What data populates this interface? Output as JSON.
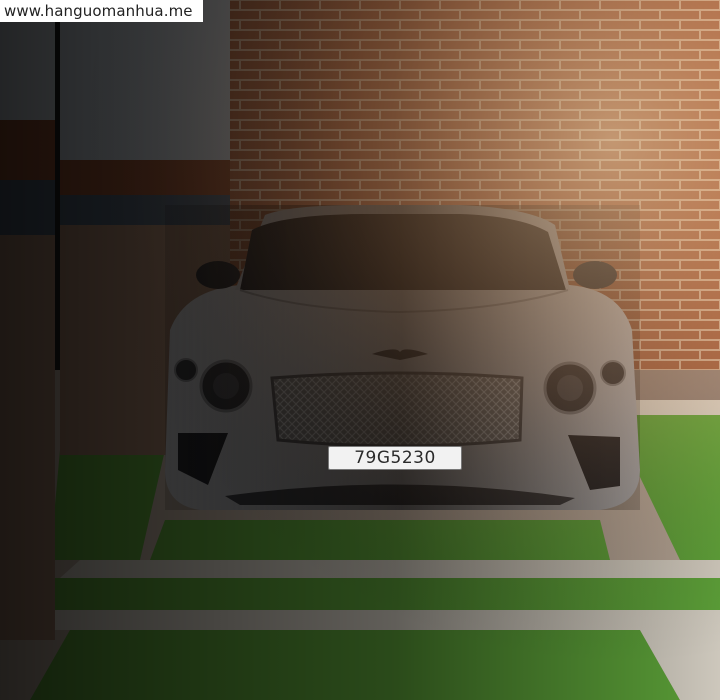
{
  "watermark": {
    "text": "www.hanguomanhua.me"
  },
  "car": {
    "license_plate": "79G5230"
  },
  "colors": {
    "brick": "#9c5a3c",
    "mortar": "#c9a68c",
    "parking_green": "#5fa63a",
    "parking_line": "#d8d2c6",
    "car_body": "#cfcfd2",
    "pillar_stripe": "#8a4a2e"
  }
}
